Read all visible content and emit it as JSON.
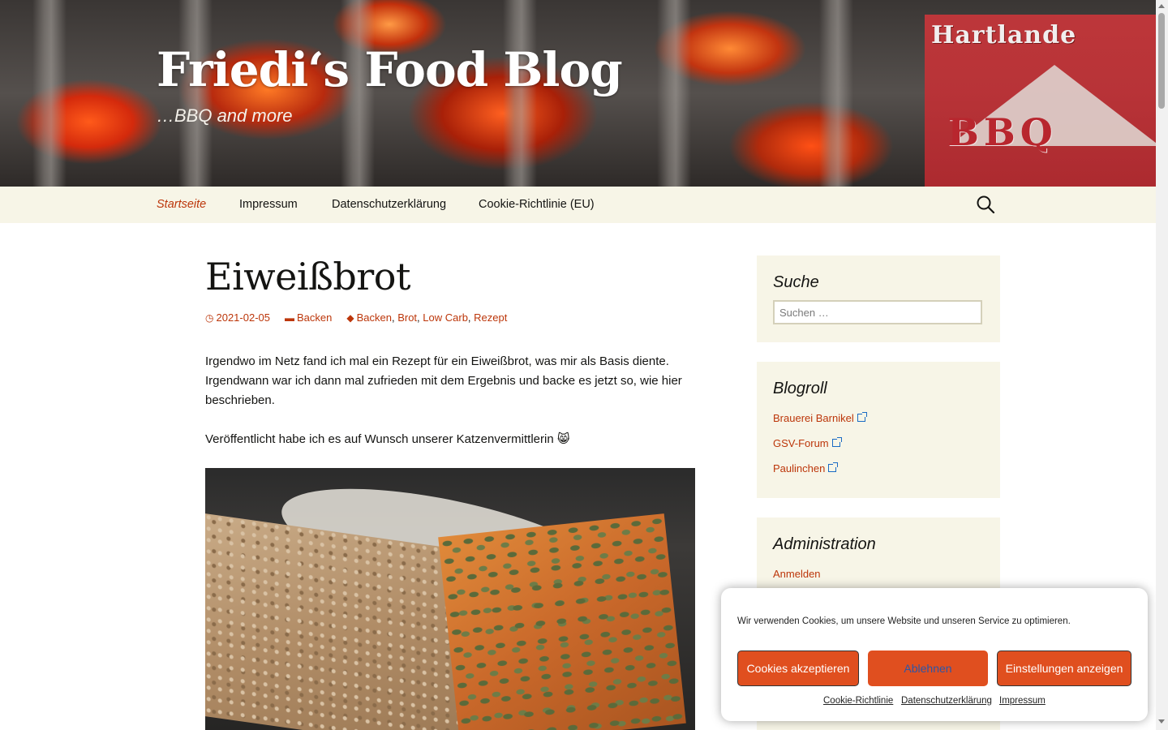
{
  "site": {
    "title": "Friedi‘s Food Blog",
    "tagline": "…BBQ and more",
    "logo_text_top": "Hartlande",
    "logo_text_bottom": "BBQ"
  },
  "nav": {
    "items": [
      {
        "label": "Startseite",
        "active": true
      },
      {
        "label": "Impressum",
        "active": false
      },
      {
        "label": "Datenschutzerklärung",
        "active": false
      },
      {
        "label": "Cookie-Richtlinie (EU)",
        "active": false
      }
    ],
    "search_icon": "search-icon"
  },
  "post": {
    "title": "Eiweißbrot",
    "date": "2021-02-05",
    "category": "Backen",
    "tags": [
      "Backen",
      "Brot",
      "Low Carb",
      "Rezept"
    ],
    "paragraphs": [
      "Irgendwo im Netz fand ich mal ein Rezept für ein Eiweißbrot, was mir als Basis diente. Irgendwann war ich dann mal zufrieden mit dem Ergebnis und backe es jetzt so, wie hier beschrieben.",
      "Veröffentlicht habe ich es auf Wunsch unserer Katzenvermittlerin 😸"
    ]
  },
  "sidebar": {
    "search": {
      "title": "Suche",
      "placeholder": "Suchen …"
    },
    "blogroll": {
      "title": "Blogroll",
      "links": [
        "Brauerei Barnikel",
        "GSV-Forum",
        "Paulinchen"
      ]
    },
    "admin": {
      "title": "Administration",
      "links": [
        "Anmelden"
      ]
    }
  },
  "cookie": {
    "text": "Wir verwenden Cookies, um unsere Website und unseren Service zu optimieren.",
    "accept": "Cookies akzeptieren",
    "deny": "Ablehnen",
    "settings": "Einstellungen anzeigen",
    "links": [
      "Cookie-Richtlinie",
      "Datenschutzerklärung",
      "Impressum"
    ]
  },
  "colors": {
    "accent": "#bc360a",
    "nav_bg": "#f7f5e7",
    "cookie_button": "#e04f1f"
  }
}
